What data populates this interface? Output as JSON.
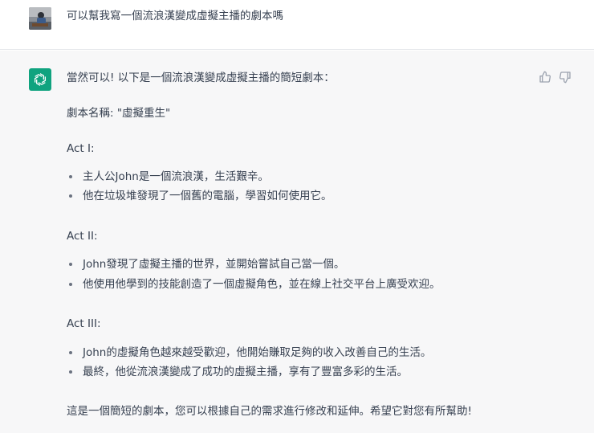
{
  "user_message": {
    "text": "可以幫我寫一個流浪漢變成虛擬主播的劇本嗎"
  },
  "assistant_message": {
    "intro": "當然可以! 以下是一個流浪漢變成虛擬主播的簡短劇本：",
    "script_title": "劇本名稱: \"虛擬重生\"",
    "acts": [
      {
        "label": "Act I:",
        "bullets": [
          "主人公John是一個流浪漢，生活艱辛。",
          "他在垃圾堆發現了一個舊的電腦，學習如何使用它。"
        ]
      },
      {
        "label": "Act II:",
        "bullets": [
          "John發現了虛擬主播的世界，並開始嘗試自己當一個。",
          "他使用他學到的技能創造了一個虛擬角色，並在線上社交平台上廣受欢迎。"
        ]
      },
      {
        "label": "Act III:",
        "bullets": [
          "John的虛擬角色越來越受歡迎，他開始賺取足夠的收入改善自己的生活。",
          "最終，他從流浪漢變成了成功的虛擬主播，享有了豐富多彩的生活。"
        ]
      }
    ],
    "closing": "這是一個簡短的劇本，您可以根據自己的需求進行修改和延伸。希望它對您有所幫助!"
  },
  "icons": {
    "user_avatar": "user-avatar",
    "assistant_logo": "openai-logo-icon",
    "feedback_up": "thumbs-up-icon",
    "feedback_down": "thumbs-down-icon"
  },
  "colors": {
    "assistant_bg": "#f7f7f8",
    "logo_bg": "#10a37f",
    "text": "#374151"
  }
}
